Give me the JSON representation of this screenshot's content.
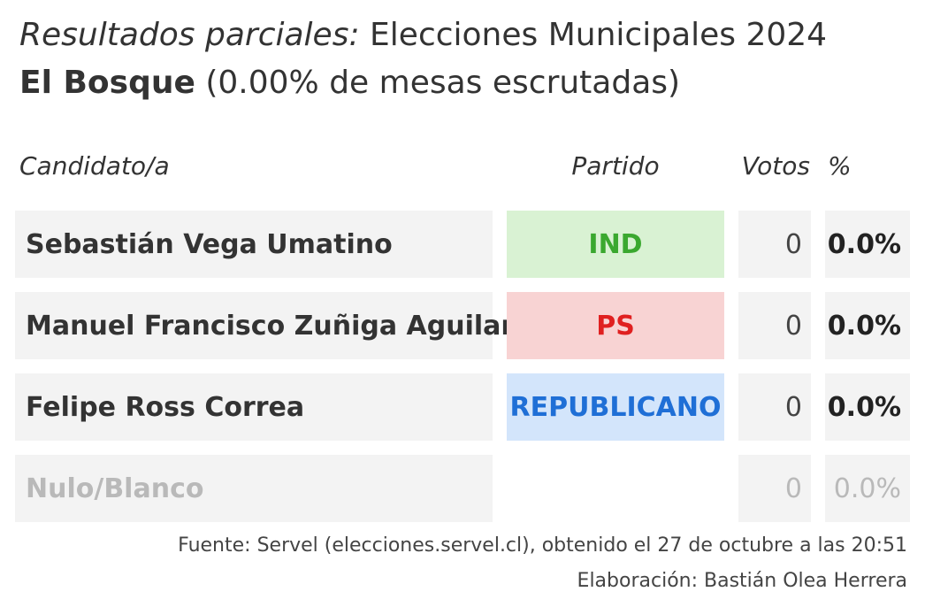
{
  "title": {
    "italic_part": "Resultados parciales:",
    "rest": "Elecciones Municipales 2024",
    "commune": "El Bosque",
    "progress": "(0.00% de mesas escrutadas)"
  },
  "headers": {
    "candidate": "Candidato/a",
    "party": "Partido",
    "votes": "Votos",
    "percent": "%"
  },
  "colors": {
    "cell_bg": "#f3f3f3",
    "muted_text": "#b9b9b9"
  },
  "chart_data": {
    "type": "table",
    "title": "Resultados parciales: Elecciones Municipales 2024",
    "subtitle": "El Bosque (0.00% de mesas escrutadas)",
    "columns": [
      "Candidato/a",
      "Partido",
      "Votos",
      "%"
    ],
    "rows": [
      {
        "candidate": "Sebastián Vega Umatino",
        "party": "IND",
        "party_bg": "#d9f2d3",
        "party_color": "#3aa82f",
        "votes": "0",
        "percent": "0.0%",
        "muted": false
      },
      {
        "candidate": "Manuel Francisco Zuñiga Aguilar",
        "party": "PS",
        "party_bg": "#f8d3d3",
        "party_color": "#e02020",
        "votes": "0",
        "percent": "0.0%",
        "muted": false
      },
      {
        "candidate": "Felipe Ross Correa",
        "party": "REPUBLICANO",
        "party_bg": "#d3e5fb",
        "party_color": "#1f6fd6",
        "votes": "0",
        "percent": "0.0%",
        "muted": false
      },
      {
        "candidate": "Nulo/Blanco",
        "party": "",
        "party_bg": "",
        "party_color": "",
        "votes": "0",
        "percent": "0.0%",
        "muted": true
      }
    ]
  },
  "footer": {
    "source": "Fuente: Servel (elecciones.servel.cl), obtenido el 27 de octubre a las 20:51",
    "author": "Elaboración: Bastián Olea Herrera"
  }
}
